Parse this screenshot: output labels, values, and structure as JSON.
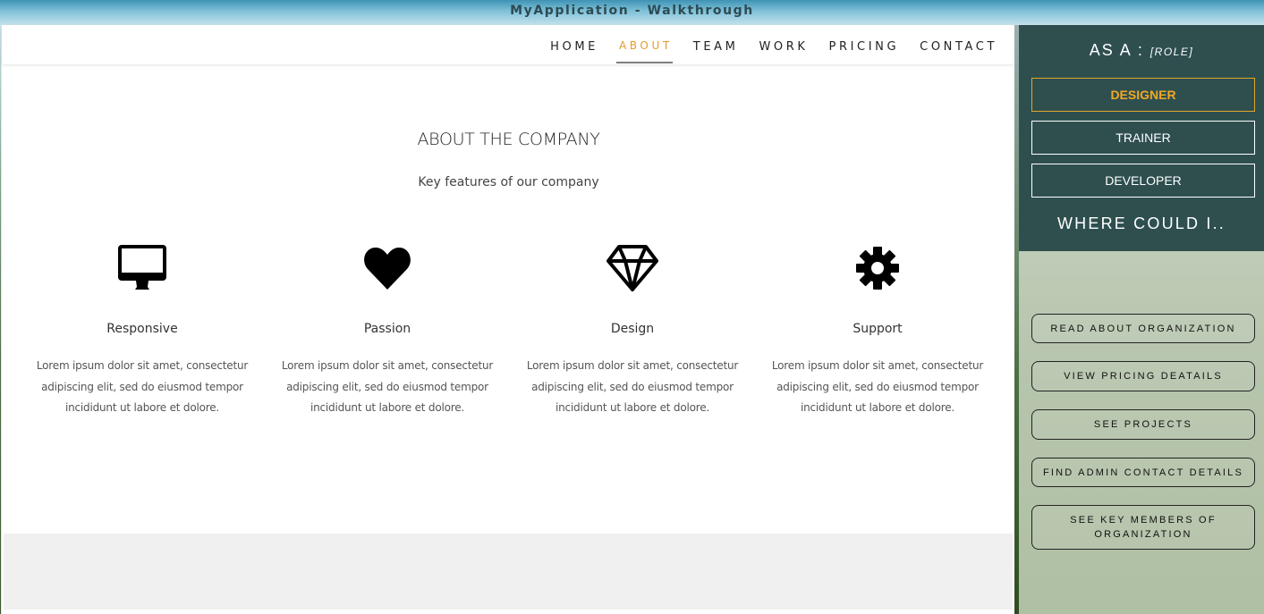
{
  "window": {
    "title": "MyApplication - Walkthrough"
  },
  "nav": {
    "items": [
      {
        "label": "HOME",
        "active": false
      },
      {
        "label": "ABOUT",
        "active": true
      },
      {
        "label": "TEAM",
        "active": false
      },
      {
        "label": "WORK",
        "active": false
      },
      {
        "label": "PRICING",
        "active": false
      },
      {
        "label": "CONTACT",
        "active": false
      }
    ],
    "active_color": "#e59a2f"
  },
  "about": {
    "title": "ABOUT THE COMPANY",
    "subtitle": "Key features of our company",
    "features": [
      {
        "icon": "desktop-icon",
        "name": "Responsive",
        "description": "Lorem ipsum dolor sit amet, consectetur adipiscing elit, sed do eiusmod tempor incididunt ut labore et dolore."
      },
      {
        "icon": "heart-icon",
        "name": "Passion",
        "description": "Lorem ipsum dolor sit amet, consectetur adipiscing elit, sed do eiusmod tempor incididunt ut labore et dolore."
      },
      {
        "icon": "diamond-icon",
        "name": "Design",
        "description": "Lorem ipsum dolor sit amet, consectetur adipiscing elit, sed do eiusmod tempor incididunt ut labore et dolore."
      },
      {
        "icon": "gear-icon",
        "name": "Support",
        "description": "Lorem ipsum dolor sit amet, consectetur adipiscing elit, sed do eiusmod tempor incididunt ut labore et dolore."
      }
    ]
  },
  "walkthrough": {
    "role_heading": "AS A :",
    "role_placeholder": "[ROLE]",
    "roles": [
      {
        "label": "DESIGNER",
        "selected": true
      },
      {
        "label": "TRAINER",
        "selected": false
      },
      {
        "label": "DEVELOPER",
        "selected": false
      }
    ],
    "goal_heading": "WHERE COULD I..",
    "goals": [
      "READ ABOUT ORGANIZATION",
      "VIEW PRICING DEATAILS",
      "SEE PROJECTS",
      "FIND ADMIN CONTACT DETAILS",
      "SEE KEY MEMBERS OF ORGANIZATION"
    ],
    "panel_color": "#2f4f4f",
    "selected_color": "#f0aa22"
  }
}
